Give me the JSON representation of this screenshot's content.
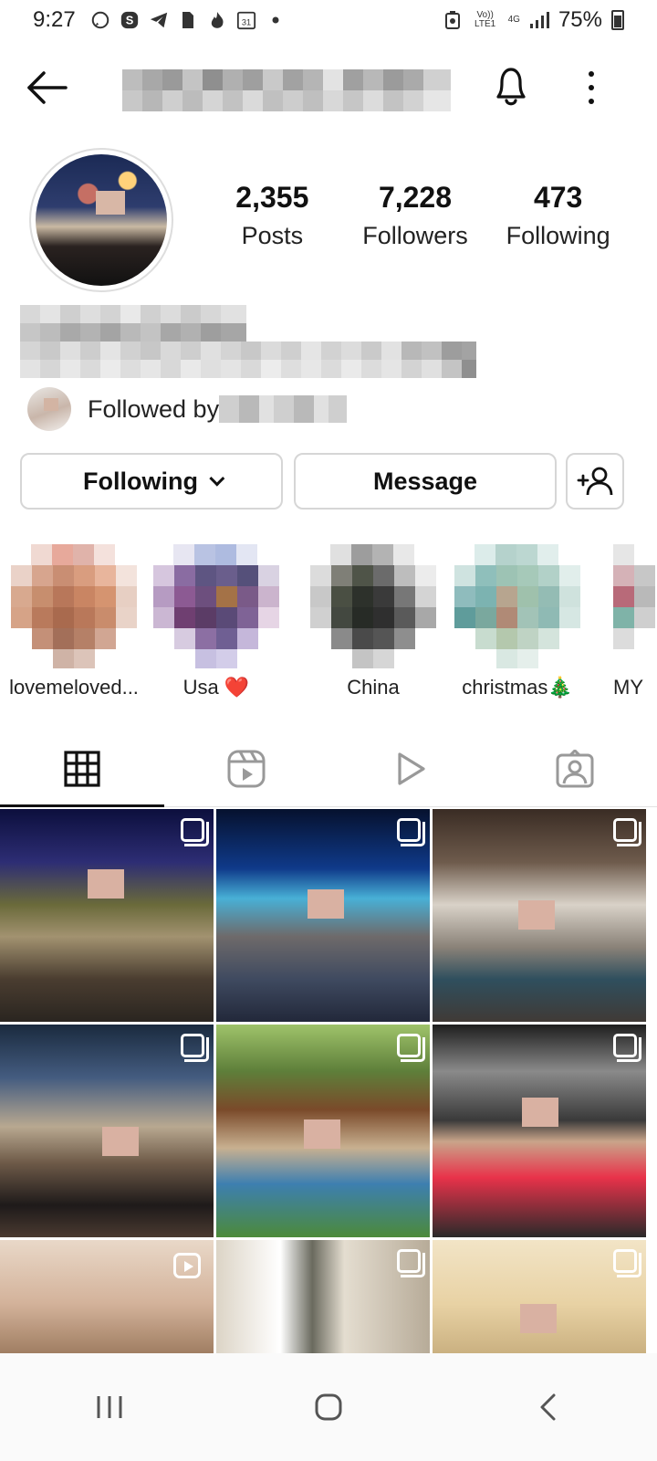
{
  "status_bar": {
    "time": "9:27",
    "volte": "Vo)) LTE1",
    "network": "4G",
    "battery": "75%"
  },
  "header": {
    "back_icon": "arrow-left-icon",
    "notifications_icon": "bell-icon",
    "more_icon": "more-vertical-icon"
  },
  "profile": {
    "stats": [
      {
        "value": "2,355",
        "label": "Posts"
      },
      {
        "value": "7,228",
        "label": "Followers"
      },
      {
        "value": "473",
        "label": "Following"
      }
    ],
    "followed_by": "Followed by"
  },
  "actions": {
    "following_label": "Following",
    "message_label": "Message",
    "add_user_icon": "add-user-icon"
  },
  "highlights": [
    {
      "label": "lovemeloved..."
    },
    {
      "label": "Usa ❤️"
    },
    {
      "label": "China"
    },
    {
      "label": "christmas🎄"
    },
    {
      "label": "MY"
    }
  ],
  "tabs": [
    {
      "name": "posts-grid",
      "icon": "grid-icon",
      "active": true
    },
    {
      "name": "reels",
      "icon": "reels-icon",
      "active": false
    },
    {
      "name": "videos",
      "icon": "play-icon",
      "active": false
    },
    {
      "name": "tagged",
      "icon": "tagged-person-icon",
      "active": false
    }
  ],
  "navbar": {
    "recents_icon": "recents-icon",
    "home_icon": "home-icon",
    "back_icon": "back-chevron-icon"
  }
}
